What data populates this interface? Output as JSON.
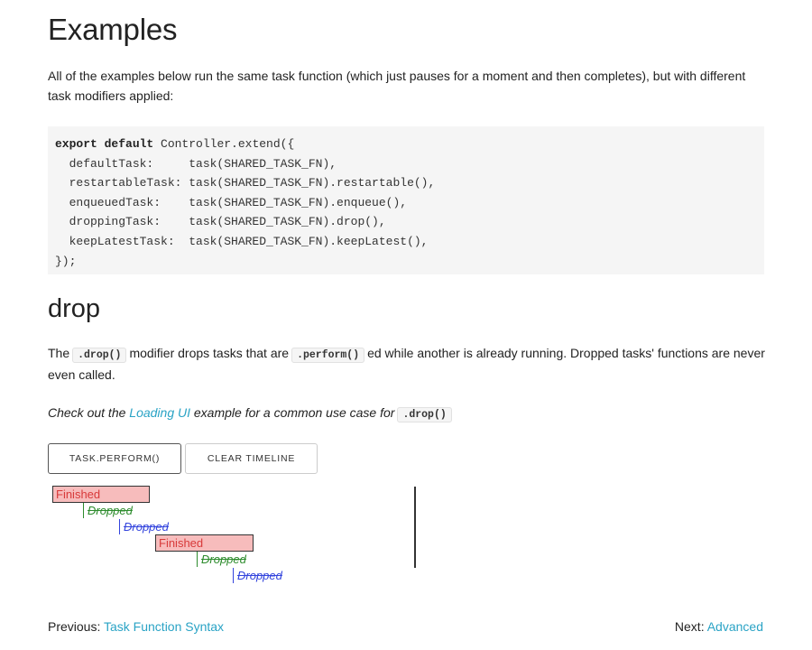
{
  "page": {
    "title": "Examples",
    "intro": "All of the examples below run the same task function (which just pauses for a moment and then completes), but with different task modifiers applied:"
  },
  "code_lines": [
    "export default Controller.extend({",
    "  defaultTask:     task(SHARED_TASK_FN),",
    "  restartableTask: task(SHARED_TASK_FN).restartable(),",
    "  enqueuedTask:    task(SHARED_TASK_FN).enqueue(),",
    "  droppingTask:    task(SHARED_TASK_FN).drop(),",
    "  keepLatestTask:  task(SHARED_TASK_FN).keepLatest(),",
    "});"
  ],
  "section": {
    "title": "drop",
    "desc_the": "The",
    "desc_code1": ".drop()",
    "desc_mid": "modifier drops tasks that are",
    "desc_code2": ".perform()",
    "desc_end": "ed while another is already running. Dropped tasks' functions are never even called.",
    "tip_pre": "Check out the",
    "tip_link": "Loading UI",
    "tip_mid": "example for a common use case for",
    "tip_code": ".drop()"
  },
  "buttons": {
    "perform": "task.perform()",
    "clear": "Clear Timeline"
  },
  "timeline": {
    "tasks": [
      {
        "label": "Finished",
        "state": "finished"
      },
      {
        "label": "Dropped",
        "state": "dropped",
        "color": "green"
      },
      {
        "label": "Dropped",
        "state": "dropped",
        "color": "blue"
      },
      {
        "label": "Finished",
        "state": "finished"
      },
      {
        "label": "Dropped",
        "state": "dropped",
        "color": "green"
      },
      {
        "label": "Dropped",
        "state": "dropped",
        "color": "blue"
      }
    ]
  },
  "nav": {
    "prev_label": "Previous:",
    "prev_link": "Task Function Syntax",
    "next_label": "Next:",
    "next_link": "Advanced"
  },
  "colors": {
    "link": "#2aa3c5",
    "finished_fill": "#f7bcbc",
    "finished_text": "#d83a3a",
    "dropped_green": "#2d8c2d",
    "dropped_blue": "#3344dd"
  }
}
